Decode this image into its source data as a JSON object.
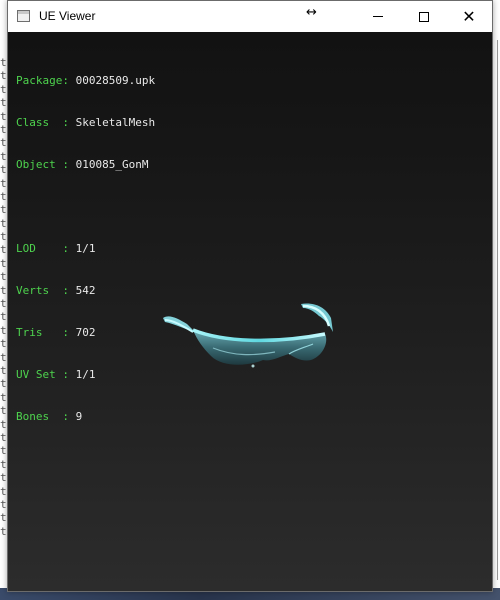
{
  "window": {
    "title": "UE Viewer",
    "resize_cursor": "↔",
    "close_glyph": "✕"
  },
  "background_console": {
    "lines": [
      "t",
      "t",
      "t",
      "t",
      "t",
      "t",
      "t",
      "t",
      "t",
      "t",
      "t",
      "t",
      "t",
      "t",
      "t",
      "t",
      "t",
      "t",
      "t",
      "t",
      "t",
      "t",
      "t",
      "t",
      "t",
      "t",
      "t",
      "t",
      "t",
      "t",
      "t",
      "t",
      "t",
      "t",
      "t",
      "t"
    ]
  },
  "info": {
    "package": {
      "label": "Package: ",
      "value": "00028509.upk"
    },
    "class": {
      "label": "Class  : ",
      "value": "SkeletalMesh"
    },
    "object": {
      "label": "Object : ",
      "value": "010085_GonM"
    },
    "lod": {
      "label": "LOD    : ",
      "value": "1/1"
    },
    "verts": {
      "label": "Verts  : ",
      "value": "542"
    },
    "tris": {
      "label": "Tris   : ",
      "value": "702"
    },
    "uvset": {
      "label": "UV Set : ",
      "value": "1/1"
    },
    "bones": {
      "label": "Bones  : ",
      "value": "9"
    }
  },
  "colors": {
    "label_green": "#4ed34e",
    "value_white": "#e9e9e9",
    "mesh_cyan": "#5fd8e0"
  },
  "icons": {
    "app": "window-app-icon",
    "minimize": "minimize-icon",
    "maximize": "maximize-icon",
    "close": "close-icon",
    "mesh": "sunglasses-mesh"
  }
}
